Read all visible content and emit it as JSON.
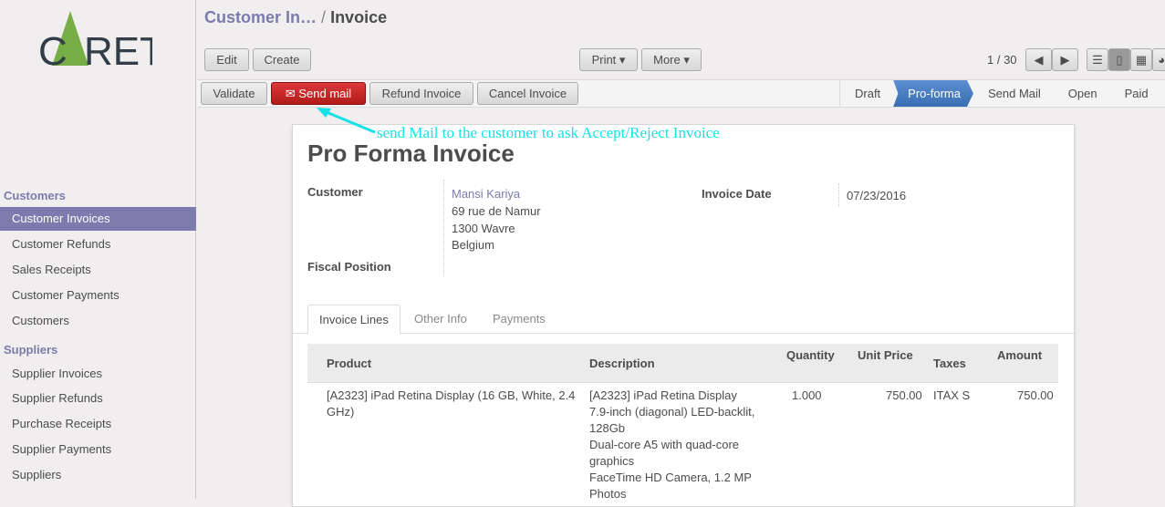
{
  "brand": {
    "logo_text": "CARET"
  },
  "sidebar": {
    "sections": [
      {
        "label": "Customers",
        "items": [
          "Customer Invoices",
          "Customer Refunds",
          "Sales Receipts",
          "Customer Payments",
          "Customers"
        ]
      },
      {
        "label": "Suppliers",
        "items": [
          "Supplier Invoices",
          "Supplier Refunds",
          "Purchase Receipts",
          "Supplier Payments",
          "Suppliers"
        ]
      }
    ],
    "active": "Customer Invoices"
  },
  "breadcrumb": {
    "parent": "Customer In…",
    "sep": "/",
    "current": "Invoice"
  },
  "toolbar": {
    "edit": "Edit",
    "create": "Create",
    "print": "Print ▾",
    "more": "More ▾",
    "pager": "1 / 30"
  },
  "actions": {
    "validate": "Validate",
    "send_mail": "Send mail",
    "refund": "Refund Invoice",
    "cancel": "Cancel Invoice"
  },
  "status": {
    "steps": [
      "Draft",
      "Pro-forma",
      "Send Mail",
      "Open",
      "Paid"
    ],
    "active": "Pro-forma",
    "active_color": "#3a6eb2"
  },
  "annotation": "send Mail to the customer to ask Accept/Reject Invoice",
  "form": {
    "title": "Pro Forma Invoice",
    "customer_label": "Customer",
    "customer_name": "Mansi Kariya",
    "address": [
      "69 rue de Namur",
      "1300 Wavre",
      "Belgium"
    ],
    "fiscal_label": "Fiscal Position",
    "date_label": "Invoice Date",
    "date": "07/23/2016"
  },
  "tabs": [
    "Invoice Lines",
    "Other Info",
    "Payments"
  ],
  "table": {
    "headers": [
      "Product",
      "Description",
      "Quantity",
      "Unit Price",
      "Taxes",
      "Amount"
    ],
    "rows": [
      {
        "product": "[A2323] iPad Retina Display (16 GB, White, 2.4 GHz)",
        "description": [
          "[A2323] iPad Retina Display",
          "7.9-inch (diagonal) LED-backlit,",
          "128Gb",
          "Dual-core A5 with quad-core",
          "graphics",
          "FaceTime HD Camera, 1.2 MP",
          "Photos"
        ],
        "quantity": "1.000",
        "unit_price": "750.00",
        "taxes": "ITAX S",
        "amount": "750.00"
      }
    ]
  }
}
